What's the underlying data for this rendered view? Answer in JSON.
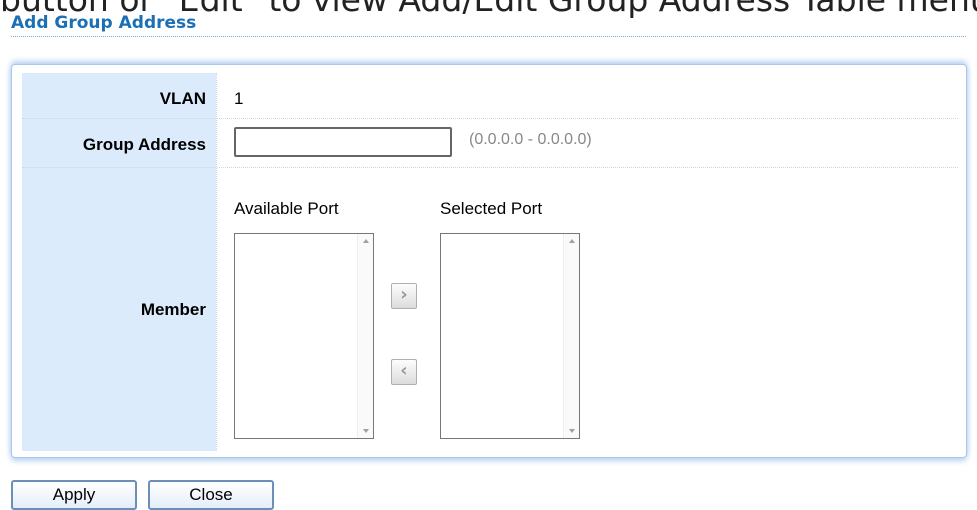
{
  "header": {
    "caption_partial": "button or \"Edit\" to view Add/Edit Group Address Table menu.",
    "section_title": "Add Group Address"
  },
  "form": {
    "vlan": {
      "label": "VLAN",
      "value": "1"
    },
    "group_address": {
      "label": "Group Address",
      "value": "",
      "placeholder": "",
      "hint": "(0.0.0.0 - 0.0.0.0)"
    },
    "member": {
      "label": "Member",
      "available_port_title": "Available Port",
      "selected_port_title": "Selected Port",
      "available_ports": [],
      "selected_ports": [],
      "add_button_icon": "chevron-right-icon",
      "remove_button_icon": "chevron-left-icon"
    }
  },
  "buttons": {
    "apply": "Apply",
    "close": "Close"
  },
  "colors": {
    "title": "#1a6fb5",
    "label_bg": "#dcebfc",
    "panel_border": "#a9c9ec",
    "button_border": "#6a8fb9"
  }
}
